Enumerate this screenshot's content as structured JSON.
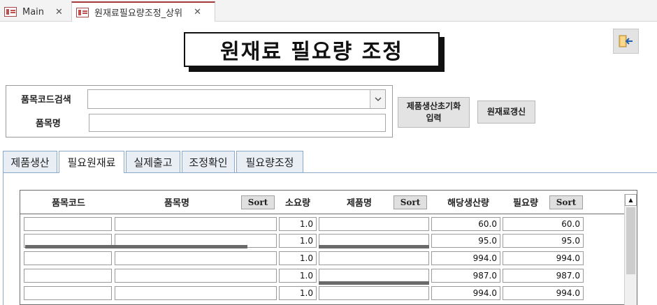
{
  "doc_tabs": [
    {
      "label": "Main",
      "close": "✕"
    },
    {
      "label": "원재료필요량조정_상위",
      "close": "✕"
    }
  ],
  "form": {
    "title": "원재료 필요량 조정",
    "exit_icon": "exit-door-icon"
  },
  "search": {
    "item_code_label": "품목코드검색",
    "item_code_value": "",
    "item_name_label": "품목명",
    "item_name_value": ""
  },
  "buttons": {
    "init_production": "제품생산초기화\n입력",
    "refresh_material": "원재료갱신"
  },
  "section_tabs": [
    "제품생산",
    "필요원재료",
    "실제출고",
    "조정확인",
    "필요량조정"
  ],
  "active_section_tab": "필요원재료",
  "grid": {
    "headers": {
      "item_code": "품목코드",
      "item_name": "품목명",
      "consumption": "소요량",
      "product_name": "제품명",
      "production_qty": "해당생산량",
      "required_qty": "필요량"
    },
    "sort_label": "Sort",
    "rows": [
      {
        "consumption": "1.0",
        "production_qty": "60.0",
        "required_qty": "60.0"
      },
      {
        "consumption": "1.0",
        "production_qty": "95.0",
        "required_qty": "95.0"
      },
      {
        "consumption": "1.0",
        "production_qty": "994.0",
        "required_qty": "994.0"
      },
      {
        "consumption": "1.0",
        "production_qty": "987.0",
        "required_qty": "987.0"
      },
      {
        "consumption": "1.0",
        "production_qty": "994.0",
        "required_qty": "994.0"
      }
    ]
  },
  "colors": {
    "active_tab_accent": "#a33a3a",
    "tab_border": "#8aa8c8",
    "button_face": "#e3e3e3"
  }
}
